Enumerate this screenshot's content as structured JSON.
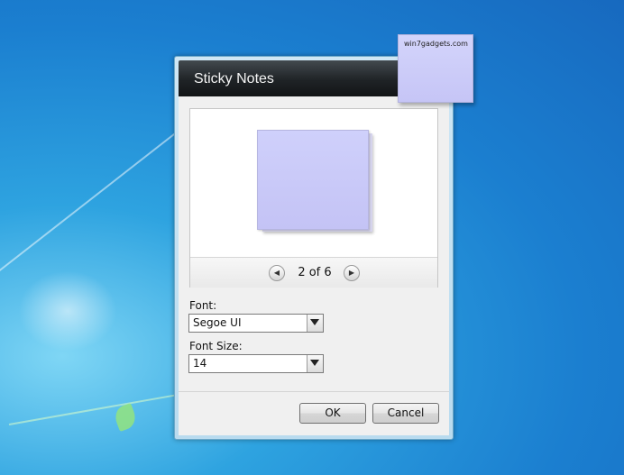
{
  "dialog": {
    "title": "Sticky Notes",
    "preview": {
      "counter": "2 of 6"
    },
    "font": {
      "label": "Font:",
      "value": "Segoe UI"
    },
    "font_size": {
      "label": "Font Size:",
      "value": "14"
    },
    "buttons": {
      "ok": "OK",
      "cancel": "Cancel"
    }
  },
  "desktop_note": {
    "text": "win7gadgets.com"
  },
  "colors": {
    "note": "#c8c8f8",
    "titlebar": "#1f2326",
    "desktop": "#1b7fd0"
  },
  "icons": {
    "prev": "chevron-left-icon",
    "next": "chevron-right-icon",
    "dropdown": "chevron-down-icon"
  }
}
